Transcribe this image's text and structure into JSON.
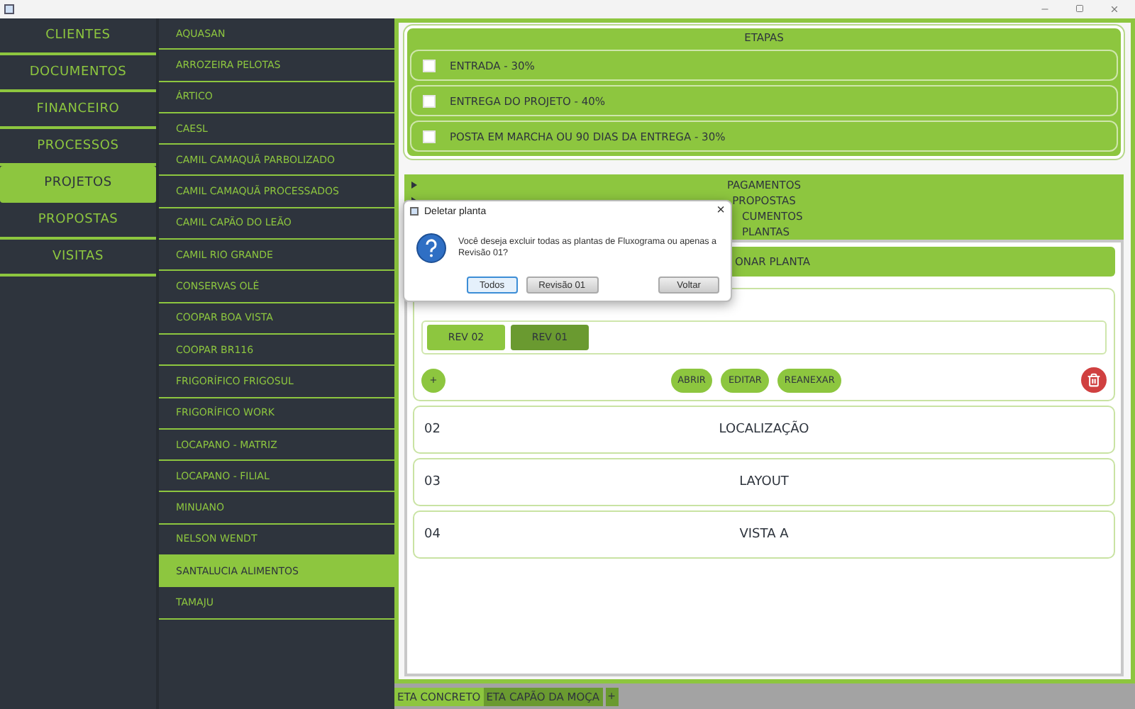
{
  "menu": [
    {
      "label": "CLIENTES",
      "selected": false
    },
    {
      "label": "DOCUMENTOS",
      "selected": false
    },
    {
      "label": "FINANCEIRO",
      "selected": false
    },
    {
      "label": "PROCESSOS",
      "selected": false
    },
    {
      "label": "PROJETOS",
      "selected": true
    },
    {
      "label": "PROPOSTAS",
      "selected": false
    },
    {
      "label": "VISITAS",
      "selected": false
    }
  ],
  "clients": [
    {
      "label": "AQUASAN",
      "selected": false
    },
    {
      "label": "ARROZEIRA PELOTAS",
      "selected": false
    },
    {
      "label": "ÁRTICO",
      "selected": false
    },
    {
      "label": "CAESL",
      "selected": false
    },
    {
      "label": "CAMIL CAMAQUÃ PARBOLIZADO",
      "selected": false
    },
    {
      "label": "CAMIL CAMAQUÃ PROCESSADOS",
      "selected": false
    },
    {
      "label": "CAMIL CAPÃO DO LEÃO",
      "selected": false
    },
    {
      "label": "CAMIL RIO GRANDE",
      "selected": false
    },
    {
      "label": "CONSERVAS OLÉ",
      "selected": false
    },
    {
      "label": "COOPAR BOA VISTA",
      "selected": false
    },
    {
      "label": "COOPAR BR116",
      "selected": false
    },
    {
      "label": "FRIGORÍFICO FRIGOSUL",
      "selected": false
    },
    {
      "label": "FRIGORÍFICO WORK",
      "selected": false
    },
    {
      "label": "LOCAPANO - MATRIZ",
      "selected": false
    },
    {
      "label": "LOCAPANO - FILIAL",
      "selected": false
    },
    {
      "label": "MINUANO",
      "selected": false
    },
    {
      "label": "NELSON WENDT",
      "selected": false
    },
    {
      "label": "SANTALUCIA ALIMENTOS",
      "selected": true
    },
    {
      "label": "TAMAJU",
      "selected": false
    }
  ],
  "etapas": {
    "title": "ETAPAS",
    "items": [
      {
        "label": "ENTRADA - 30%",
        "checked": false
      },
      {
        "label": "ENTREGA DO PROJETO - 40%",
        "checked": false
      },
      {
        "label": "POSTA EM MARCHA OU 90 DIAS DA ENTREGA - 30%",
        "checked": false
      }
    ]
  },
  "sections": [
    {
      "label": "PAGAMENTOS",
      "kind": "full"
    },
    {
      "label": "PROPOSTAS",
      "kind": "full"
    },
    {
      "label": "CUMENTOS",
      "kind": "clipped"
    },
    {
      "label": "PLANTAS",
      "kind": "clipped"
    }
  ],
  "plantas": {
    "add_button": "ONAR PLANTA",
    "revisions": [
      {
        "label": "REV 02",
        "selected": false
      },
      {
        "label": "REV 01",
        "selected": true
      }
    ],
    "add": "+",
    "actions": [
      "ABRIR",
      "EDITAR",
      "REANEXAR"
    ],
    "items": [
      {
        "number": "02",
        "name": "LOCALIZAÇÃO"
      },
      {
        "number": "03",
        "name": "LAYOUT"
      },
      {
        "number": "04",
        "name": "VISTA A"
      }
    ]
  },
  "tabs": [
    {
      "label": "ETA CONCRETO",
      "selected": true
    },
    {
      "label": "ETA CAPÃO DA MOÇA",
      "selected": false
    }
  ],
  "tab_add": "+",
  "dialog": {
    "title": "Deletar planta",
    "close": "×",
    "message": "Você deseja excluir todas as plantas de Fluxograma ou apenas a Revisão 01?",
    "buttons": [
      {
        "label": "Todos",
        "selected": true
      },
      {
        "label": "Revisão 01",
        "selected": false
      },
      {
        "label": "Voltar",
        "selected": false
      }
    ]
  }
}
